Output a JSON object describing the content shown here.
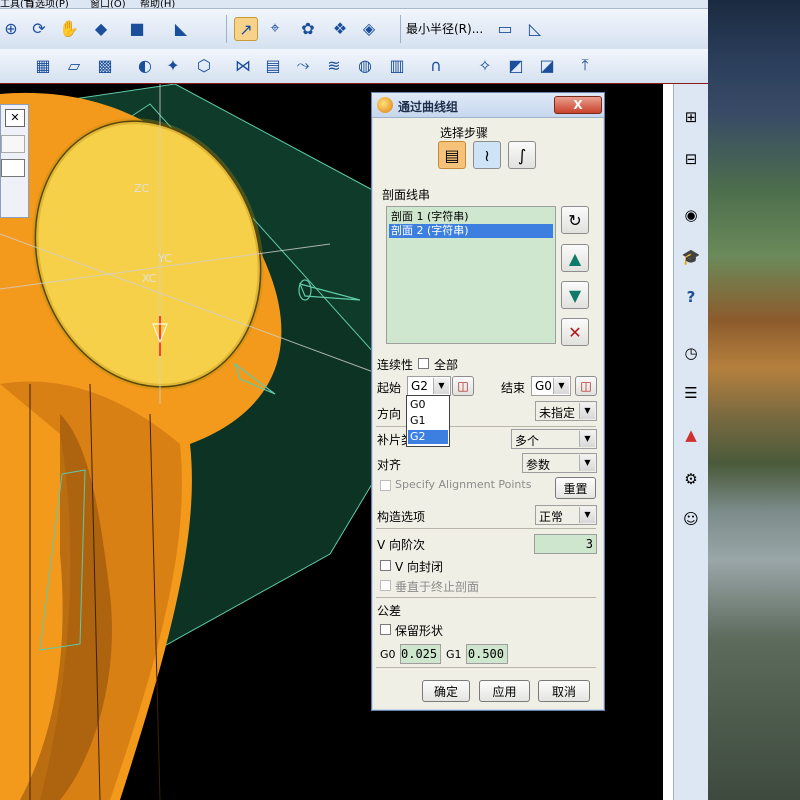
{
  "menubar": {
    "items": [
      "工具(T)",
      "首选项(P)",
      "窗口(O)",
      "帮助(H)"
    ]
  },
  "toolbar": {
    "min_radius_label": "最小半径(R)..."
  },
  "viewport": {
    "axis_labels": [
      "ZC",
      "YC",
      "XC"
    ]
  },
  "dialog": {
    "title": "通过曲线组",
    "close_label": "X",
    "select_step_label": "选择步骤",
    "section_strings_label": "剖面线串",
    "sections": [
      {
        "label": "剖面 1 (字符串)",
        "selected": false
      },
      {
        "label": "剖面 2 (字符串)",
        "selected": true
      }
    ],
    "continuity_label": "连续性",
    "all_label": "全部",
    "start_label": "起始",
    "start_value": "G2",
    "end_label": "结束",
    "end_value": "G0",
    "direction_label": "方向",
    "direction_value": "未指定",
    "patch_label": "补片类",
    "patch_value": "多个",
    "align_label": "对齐",
    "align_value": "参数",
    "specify_alignment_label": "Specify Alignment Points",
    "reset_label": "重置",
    "construct_label": "构造选项",
    "construct_value": "正常",
    "v_degree_label": "V 向阶次",
    "v_degree_value": "3",
    "v_closed_label": "V 向封闭",
    "perp_label": "垂直于终止剖面",
    "tolerance_label": "公差",
    "keep_shape_label": "保留形状",
    "g0_label": "G0",
    "g0_value": "0.025",
    "g1_label": "G1",
    "g1_value": "0.500",
    "ok_label": "确定",
    "apply_label": "应用",
    "cancel_label": "取消",
    "dropdown_options": [
      {
        "label": "G0",
        "selected": false
      },
      {
        "label": "G1",
        "selected": false
      },
      {
        "label": "G2",
        "selected": true
      }
    ]
  },
  "colors": {
    "accent": "#3d7fe0",
    "model_orange": "#f39a1c",
    "sheet_green": "#0f3b2a",
    "title_bar": "#c7d7ee"
  }
}
